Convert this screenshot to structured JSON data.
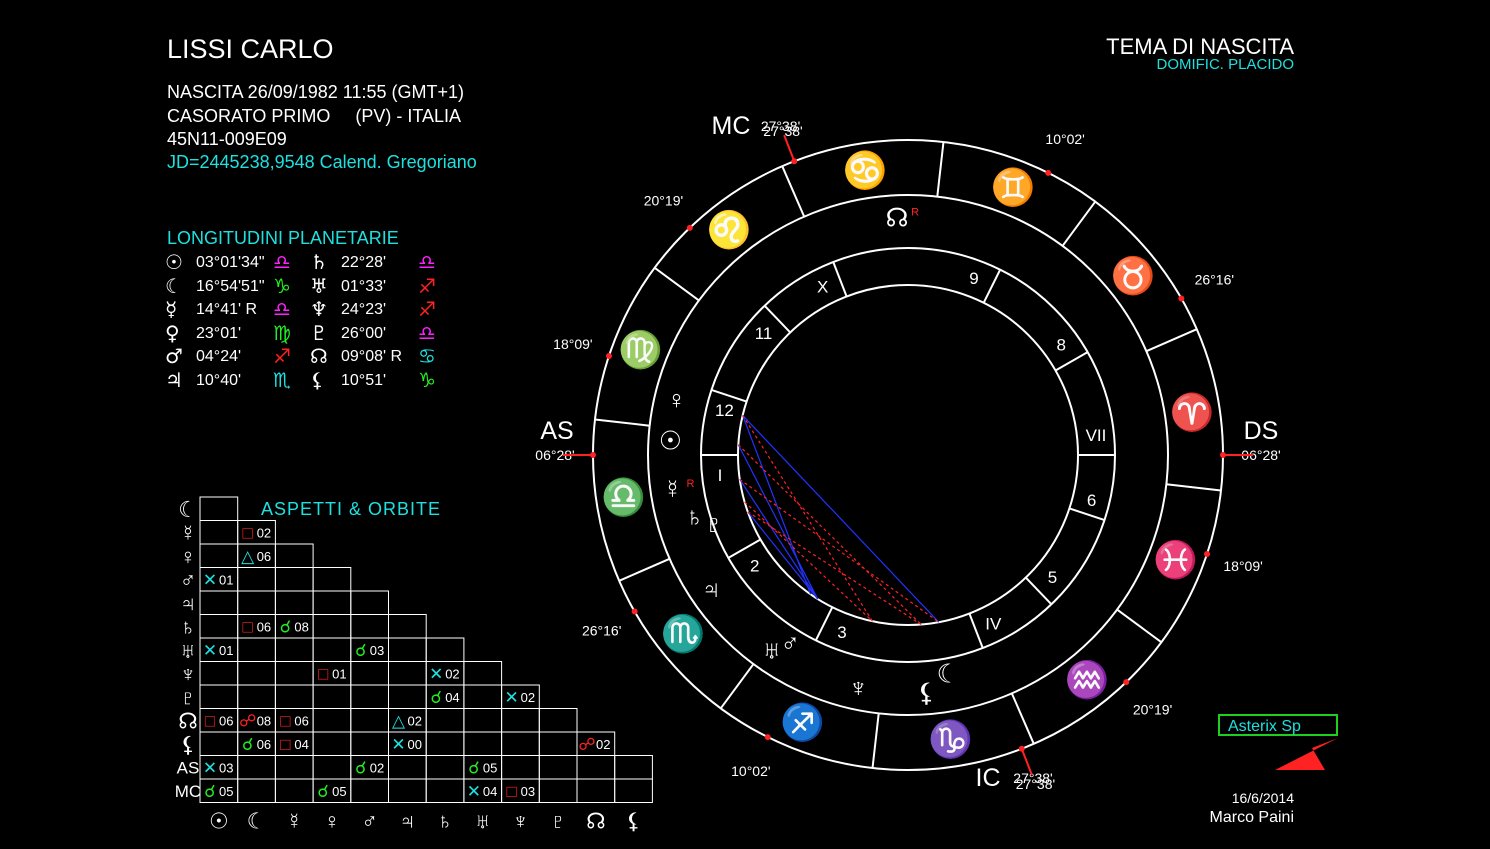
{
  "header": {
    "name": "LISSI CARLO",
    "birth_line": "NASCITA 26/09/1982 11:55 (GMT+1)",
    "place_line": "CASORATO PRIMO     (PV) - ITALIA",
    "coords_line": "45N11-009E09",
    "jd_line": "JD=2445238,9548  Calend. Gregoriano"
  },
  "chart_title": "TEMA DI NASCITA",
  "chart_subtitle": "DOMIFIC. PLACIDO",
  "longitudes": {
    "title": "LONGITUDINI PLANETARIE",
    "left": [
      {
        "planet": "sun-icon",
        "glyph": "☉",
        "value": "03°01'34\"",
        "sign": "libra-icon",
        "sign_glyph": "♎",
        "sign_color": "#ff22ff"
      },
      {
        "planet": "moon-icon",
        "glyph": "☾",
        "value": "16°54'51\"",
        "sign": "capricorn-icon",
        "sign_glyph": "♑",
        "sign_color": "#22ee22"
      },
      {
        "planet": "mercury-icon",
        "glyph": "☿",
        "value": "14°41' R",
        "sign": "libra-icon",
        "sign_glyph": "♎",
        "sign_color": "#ff22ff"
      },
      {
        "planet": "venus-icon",
        "glyph": "♀",
        "value": "23°01'",
        "sign": "virgo-icon",
        "sign_glyph": "♍",
        "sign_color": "#22ee22"
      },
      {
        "planet": "mars-icon",
        "glyph": "♂",
        "value": "04°24'",
        "sign": "sagittarius-icon",
        "sign_glyph": "♐",
        "sign_color": "#ff2222"
      },
      {
        "planet": "jupiter-icon",
        "glyph": "♃",
        "value": "10°40'",
        "sign": "scorpio-icon",
        "sign_glyph": "♏",
        "sign_color": "#1ee0e0"
      }
    ],
    "right": [
      {
        "planet": "saturn-icon",
        "glyph": "♄",
        "value": "22°28'",
        "sign": "libra-icon",
        "sign_glyph": "♎",
        "sign_color": "#ff22ff"
      },
      {
        "planet": "uranus-icon",
        "glyph": "♅",
        "value": "01°33'",
        "sign": "sagittarius-icon",
        "sign_glyph": "♐",
        "sign_color": "#ff2222"
      },
      {
        "planet": "neptune-icon",
        "glyph": "♆",
        "value": "24°23'",
        "sign": "sagittarius-icon",
        "sign_glyph": "♐",
        "sign_color": "#ff2222"
      },
      {
        "planet": "pluto-icon",
        "glyph": "♇",
        "value": "26°00'",
        "sign": "libra-icon",
        "sign_glyph": "♎",
        "sign_color": "#ff22ff"
      },
      {
        "planet": "node-icon",
        "glyph": "☊",
        "value": "09°08' R",
        "sign": "cancer-icon",
        "sign_glyph": "♋",
        "sign_color": "#1ee0e0"
      },
      {
        "planet": "lilith-icon",
        "glyph": "⚸",
        "value": "10°51'",
        "sign": "capricorn-icon",
        "sign_glyph": "♑",
        "sign_color": "#22ee22"
      }
    ]
  },
  "aspects": {
    "title": "ASPETTI  &  ORBITE",
    "row_labels": [
      "☾",
      "☿",
      "♀",
      "♂",
      "♃",
      "♄",
      "♅",
      "♆",
      "♇",
      "☊",
      "⚸",
      "AS",
      "MC"
    ],
    "col_labels": [
      "☉",
      "☾",
      "☿",
      "♀",
      "♂",
      "♃",
      "♄",
      "♅",
      "♆",
      "♇",
      "☊",
      "⚸"
    ],
    "cells": [
      {
        "row": 1,
        "col": 1,
        "type": "square",
        "glyph": "□",
        "color": "#ff2222",
        "orb": "02"
      },
      {
        "row": 2,
        "col": 1,
        "type": "trine",
        "glyph": "△",
        "color": "#1ee0e0",
        "orb": "06"
      },
      {
        "row": 3,
        "col": 0,
        "type": "sextile",
        "glyph": "✕",
        "color": "#1ee0e0",
        "orb": "01"
      },
      {
        "row": 5,
        "col": 1,
        "type": "square",
        "glyph": "□",
        "color": "#ff2222",
        "orb": "06"
      },
      {
        "row": 5,
        "col": 2,
        "type": "conjunction",
        "glyph": "☌",
        "color": "#22ee22",
        "orb": "08"
      },
      {
        "row": 6,
        "col": 0,
        "type": "sextile",
        "glyph": "✕",
        "color": "#1ee0e0",
        "orb": "01"
      },
      {
        "row": 6,
        "col": 4,
        "type": "conjunction",
        "glyph": "☌",
        "color": "#22ee22",
        "orb": "03"
      },
      {
        "row": 7,
        "col": 3,
        "type": "square",
        "glyph": "□",
        "color": "#ff2222",
        "orb": "01"
      },
      {
        "row": 7,
        "col": 6,
        "type": "sextile",
        "glyph": "✕",
        "color": "#1ee0e0",
        "orb": "02"
      },
      {
        "row": 8,
        "col": 6,
        "type": "conjunction",
        "glyph": "☌",
        "color": "#22ee22",
        "orb": "04"
      },
      {
        "row": 8,
        "col": 8,
        "type": "sextile",
        "glyph": "✕",
        "color": "#1ee0e0",
        "orb": "02"
      },
      {
        "row": 9,
        "col": 0,
        "type": "square",
        "glyph": "□",
        "color": "#ff2222",
        "orb": "06"
      },
      {
        "row": 9,
        "col": 1,
        "type": "opposition",
        "glyph": "☍",
        "color": "#ff2222",
        "orb": "08"
      },
      {
        "row": 9,
        "col": 2,
        "type": "square",
        "glyph": "□",
        "color": "#ff2222",
        "orb": "06"
      },
      {
        "row": 9,
        "col": 5,
        "type": "trine",
        "glyph": "△",
        "color": "#1ee0e0",
        "orb": "02"
      },
      {
        "row": 10,
        "col": 1,
        "type": "conjunction",
        "glyph": "☌",
        "color": "#22ee22",
        "orb": "06"
      },
      {
        "row": 10,
        "col": 2,
        "type": "square",
        "glyph": "□",
        "color": "#ff2222",
        "orb": "04"
      },
      {
        "row": 10,
        "col": 5,
        "type": "sextile",
        "glyph": "✕",
        "color": "#1ee0e0",
        "orb": "00"
      },
      {
        "row": 10,
        "col": 10,
        "type": "opposition",
        "glyph": "☍",
        "color": "#ff2222",
        "orb": "02"
      },
      {
        "row": 11,
        "col": 0,
        "type": "sextile",
        "glyph": "✕",
        "color": "#1ee0e0",
        "orb": "03"
      },
      {
        "row": 11,
        "col": 4,
        "type": "conjunction",
        "glyph": "☌",
        "color": "#22ee22",
        "orb": "02"
      },
      {
        "row": 11,
        "col": 7,
        "type": "conjunction",
        "glyph": "☌",
        "color": "#22ee22",
        "orb": "05"
      },
      {
        "row": 12,
        "col": 0,
        "type": "conjunction",
        "glyph": "☌",
        "color": "#22ee22",
        "orb": "05"
      },
      {
        "row": 12,
        "col": 3,
        "type": "conjunction",
        "glyph": "☌",
        "color": "#22ee22",
        "orb": "05"
      },
      {
        "row": 12,
        "col": 7,
        "type": "sextile",
        "glyph": "✕",
        "color": "#1ee0e0",
        "orb": "04"
      },
      {
        "row": 12,
        "col": 8,
        "type": "square",
        "glyph": "□",
        "color": "#ff2222",
        "orb": "03"
      }
    ]
  },
  "wheel": {
    "asc_longitude": 186.467,
    "axes": {
      "as_label": "AS",
      "ds_label": "DS",
      "mc_label": "MC",
      "ic_label": "IC",
      "as_deg": "06°28'",
      "ds_deg": "06°28'",
      "mc_deg": "27°38'",
      "ic_deg": "27°38'"
    },
    "cusps": [
      {
        "house": "I",
        "longitude": 186.467,
        "degree_label": "06°28'",
        "label_pos": "house-1"
      },
      {
        "house": "2",
        "longitude": 216.267,
        "degree_label": "26°16'",
        "label_pos": "house-2"
      },
      {
        "house": "3",
        "longitude": 250.033,
        "degree_label": "10°02'",
        "label_pos": "house-3"
      },
      {
        "house": "IV",
        "longitude": 297.633,
        "degree_label": "27°38'",
        "label_pos": "house-4"
      },
      {
        "house": "5",
        "longitude": 320.317,
        "degree_label": "20°19'",
        "label_pos": "house-5"
      },
      {
        "house": "6",
        "longitude": 348.15,
        "degree_label": "18°09'",
        "label_pos": "house-6"
      },
      {
        "house": "VII",
        "longitude": 6.467,
        "degree_label": "06°28'",
        "label_pos": "house-7"
      },
      {
        "house": "8",
        "longitude": 36.267,
        "degree_label": "26°16'",
        "label_pos": "house-8"
      },
      {
        "house": "9",
        "longitude": 70.033,
        "degree_label": "10°02'",
        "label_pos": "house-9"
      },
      {
        "house": "X",
        "longitude": 117.633,
        "degree_label": "27°38'",
        "label_pos": "house-10"
      },
      {
        "house": "11",
        "longitude": 140.317,
        "degree_label": "20°19'",
        "label_pos": "house-11"
      },
      {
        "house": "12",
        "longitude": 168.15,
        "degree_label": "18°09'",
        "label_pos": "house-12"
      }
    ],
    "signs": [
      {
        "name": "aries-icon",
        "glyph": "♈",
        "color": "#ff2222"
      },
      {
        "name": "taurus-icon",
        "glyph": "♉",
        "color": "#22ee22"
      },
      {
        "name": "gemini-icon",
        "glyph": "♊",
        "color": "#ff22ff"
      },
      {
        "name": "cancer-icon",
        "glyph": "♋",
        "color": "#1ee0e0"
      },
      {
        "name": "leo-icon",
        "glyph": "♌",
        "color": "#ff2222"
      },
      {
        "name": "virgo-icon",
        "glyph": "♍",
        "color": "#22ee22"
      },
      {
        "name": "libra-icon",
        "glyph": "♎",
        "color": "#ff22ff"
      },
      {
        "name": "scorpio-icon",
        "glyph": "♏",
        "color": "#1ee0e0"
      },
      {
        "name": "sagittarius-icon",
        "glyph": "♐",
        "color": "#ff2222"
      },
      {
        "name": "capricorn-icon",
        "glyph": "♑",
        "color": "#22ee22"
      },
      {
        "name": "aquarius-icon",
        "glyph": "♒",
        "color": "#ff22ff"
      },
      {
        "name": "pisces-icon",
        "glyph": "♓",
        "color": "#1ee0e0"
      }
    ],
    "planets": [
      {
        "name": "venus-icon",
        "glyph": "♀",
        "longitude": 173.0
      },
      {
        "name": "sun-icon",
        "glyph": "☉",
        "longitude": 183.0
      },
      {
        "name": "mercury-icon",
        "glyph": "☿",
        "longitude": 194.7,
        "retro": "R"
      },
      {
        "name": "saturn-icon",
        "glyph": "♄",
        "longitude": 202.5
      },
      {
        "name": "pluto-icon",
        "glyph": "♇",
        "longitude": 206.0
      },
      {
        "name": "jupiter-icon",
        "glyph": "♃",
        "longitude": 220.7
      },
      {
        "name": "uranus-icon",
        "glyph": "♅",
        "longitude": 241.5
      },
      {
        "name": "mars-icon",
        "glyph": "♂",
        "longitude": 244.4
      },
      {
        "name": "neptune-icon",
        "glyph": "♆",
        "longitude": 264.4
      },
      {
        "name": "lilith-icon",
        "glyph": "⚸",
        "longitude": 280.9
      },
      {
        "name": "moon-icon",
        "glyph": "☾",
        "longitude": 286.9
      },
      {
        "name": "node-icon",
        "glyph": "☊",
        "longitude": 99.1,
        "retro": "R"
      }
    ],
    "aspect_lines": [
      {
        "from": 173.0,
        "to": 241.5,
        "color": "#2233ff",
        "style": "solid"
      },
      {
        "from": 183.0,
        "to": 244.4,
        "color": "#2233ff",
        "style": "solid"
      },
      {
        "from": 194.7,
        "to": 244.4,
        "color": "#2233ff",
        "style": "solid"
      },
      {
        "from": 173.0,
        "to": 286.9,
        "color": "#2233ff",
        "style": "solid"
      },
      {
        "from": 206.0,
        "to": 244.4,
        "color": "#2233ff",
        "style": "solid"
      },
      {
        "from": 183.0,
        "to": 280.9,
        "color": "#ff2222",
        "style": "dashed"
      },
      {
        "from": 194.7,
        "to": 286.9,
        "color": "#ff2222",
        "style": "dashed"
      },
      {
        "from": 206.0,
        "to": 280.9,
        "color": "#ff2222",
        "style": "dashed"
      },
      {
        "from": 202.5,
        "to": 264.4,
        "color": "#ff2222",
        "style": "dashed"
      },
      {
        "from": 173.0,
        "to": 264.4,
        "color": "#ff2222",
        "style": "dashed"
      }
    ]
  },
  "badge": "Asterix Sp",
  "footer": {
    "date": "16/6/2014",
    "author": "Marco Paini"
  }
}
